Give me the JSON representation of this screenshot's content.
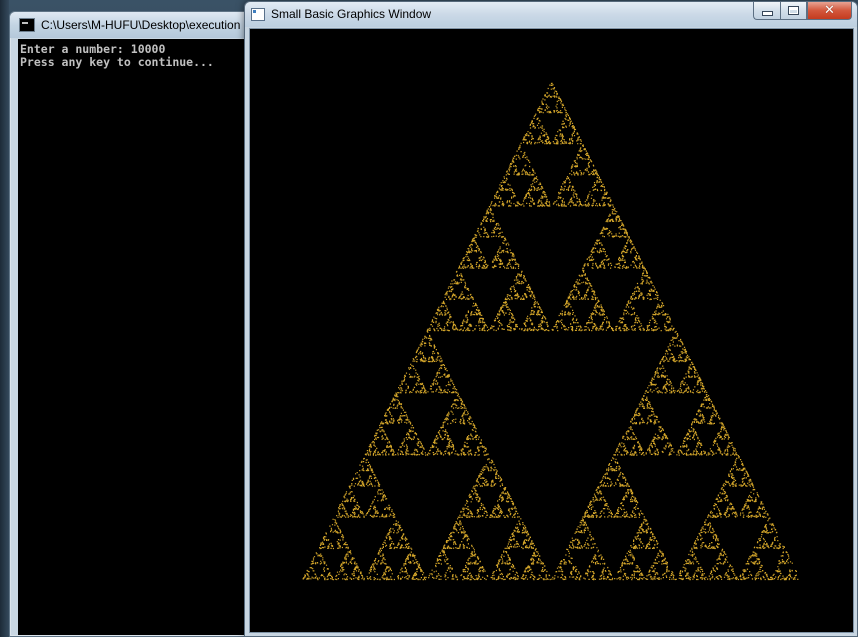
{
  "console_window": {
    "title": "C:\\Users\\M-HUFU\\Desktop\\execution",
    "lines": [
      "Enter a number: 10000",
      "Press any key to continue..."
    ]
  },
  "graphics_window": {
    "title": "Small Basic Graphics Window",
    "buttons": {
      "minimize": "minimize",
      "maximize": "maximize",
      "close": "close"
    },
    "canvas": {
      "background": "#000000",
      "point_color": "#d4a62a",
      "shape": "sierpinski-triangle",
      "point_count": 10000
    }
  },
  "colors": {
    "console_text": "#c0c0c0",
    "close_button": "#c94a2e",
    "title_bar": "#c8d6e2"
  }
}
